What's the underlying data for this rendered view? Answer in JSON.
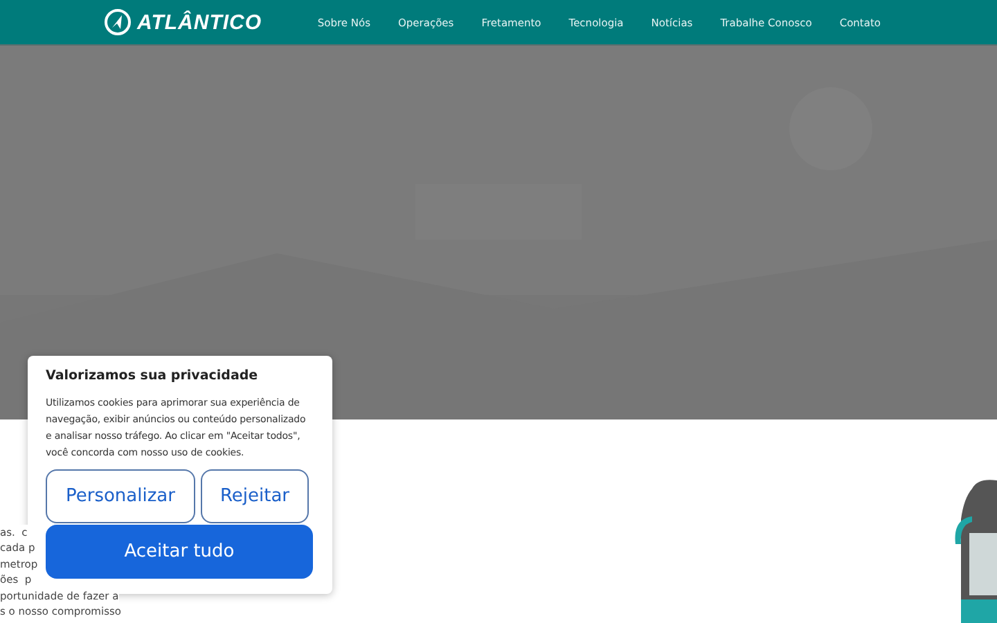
{
  "header": {
    "logo": "ATLÂNTICO",
    "nav": [
      {
        "label": "Sobre Nós"
      },
      {
        "label": "Operações"
      },
      {
        "label": "Fretamento"
      },
      {
        "label": "Tecnologia"
      },
      {
        "label": "Notícias"
      },
      {
        "label": "Trabalhe Conosco"
      },
      {
        "label": "Contato"
      }
    ]
  },
  "hero": {
    "kind": "picture"
  },
  "body_text_fragments": [
    "as.  c",
    "cada p",
    "metrop",
    "ões  p",
    "portunidade de fazer a",
    "s o nosso compromisso"
  ],
  "cookie_banner": {
    "title": "Valorizamos sua privacidade",
    "text": "Utilizamos cookies para aprimorar sua experiência de navegação, exibir anúncios ou conteúdo personalizado e analisar nosso tráfego. Ao clicar em \"Aceitar todos\", você concorda com nosso uso de cookies.",
    "buttons": [
      {
        "label": "Personalizar",
        "kind": "outline"
      },
      {
        "label": "Rejeitar",
        "kind": "outline"
      },
      {
        "label": "Aceitar tudo",
        "kind": "primary"
      }
    ]
  }
}
